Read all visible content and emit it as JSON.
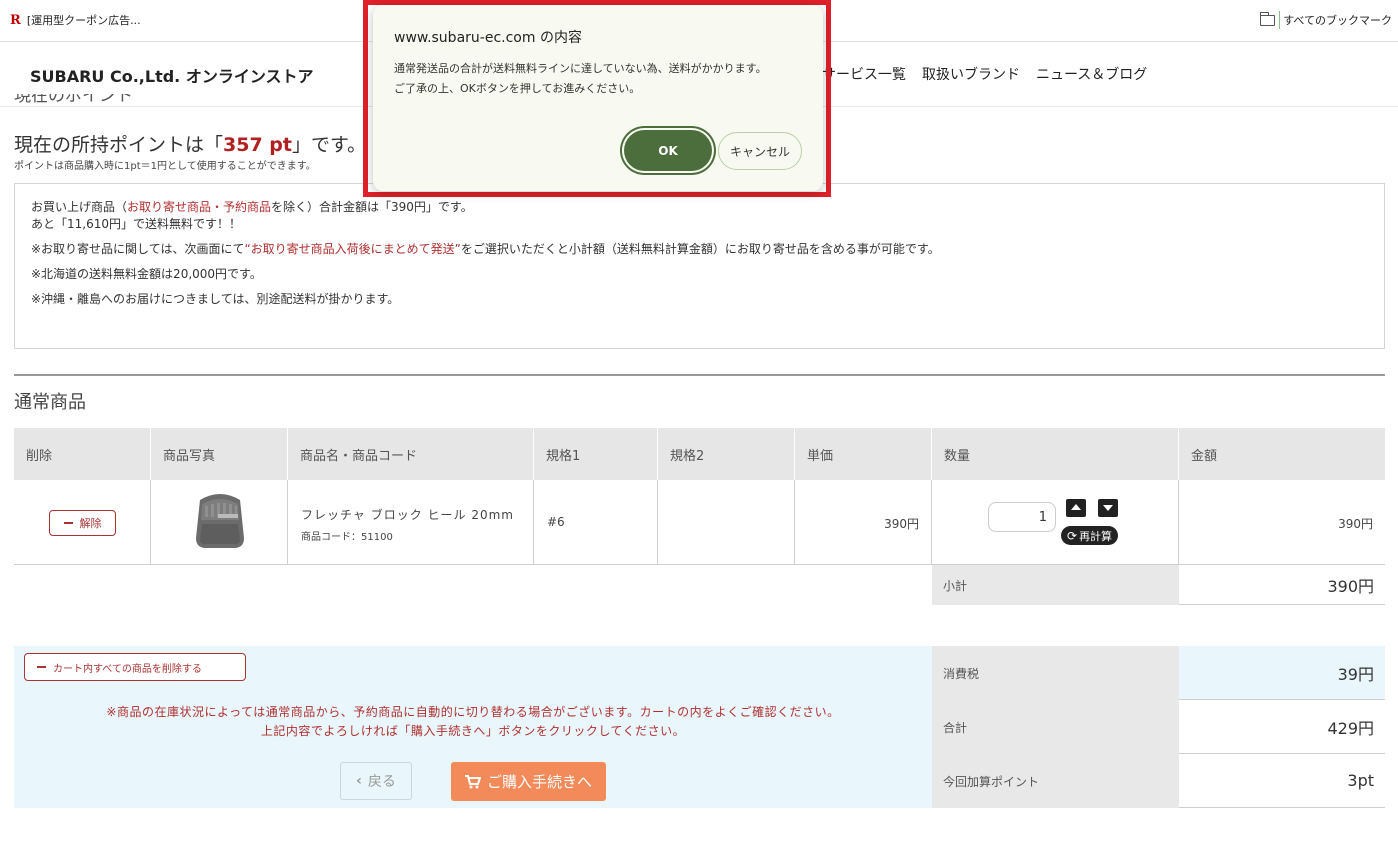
{
  "bookmarks": {
    "left_label": "[運用型クーポン広告...",
    "right_label": "すべてのブックマーク"
  },
  "header": {
    "site_title": "SUBARU Co.,Ltd. オンラインストア",
    "nav": [
      "サービス一覧",
      "取扱いブランド",
      "ニュース＆ブログ"
    ]
  },
  "points": {
    "cut_heading": "現在のポイント",
    "prefix": "現在の所持ポイントは「",
    "value": "357 pt",
    "suffix": "」です。",
    "note": "ポイントは商品購入時に1pt＝1円として使用することができます。"
  },
  "info": {
    "line1_a": "お買い上げ商品（",
    "line1_red": "お取り寄せ商品・予約商品",
    "line1_b": "を除く）合計金額は「390円」です。",
    "line2": "あと「11,610円」で送料無料です！！",
    "line3_a": "※お取り寄せ品に関しては、次画面にて",
    "line3_red": "“お取り寄せ商品入荷後にまとめて発送”",
    "line3_b": "をご選択いただくと小計額（送料無料計算金額）にお取り寄せ品を含める事が可能です。",
    "line4": "※北海道の送料無料金額は20,000円です。",
    "line5": "※沖縄・離島へのお届けにつきましては、別途配送料が掛かります。"
  },
  "section_title": "通常商品",
  "table": {
    "headers": [
      "削除",
      "商品写真",
      "商品名・商品コード",
      "規格1",
      "規格2",
      "単価",
      "数量",
      "金額"
    ],
    "row": {
      "remove_label": "解除",
      "name": "フレッチャ ブロック ヒール 20mm",
      "code": "商品コード：51100",
      "spec1": "#6",
      "spec2": "",
      "unit_price": "390円",
      "quantity": "1",
      "recalc_label": "再計算",
      "amount": "390円"
    }
  },
  "summary": {
    "subtotal_label": "小計",
    "subtotal_value": "390円",
    "tax_label": "消費税",
    "tax_value": "39円",
    "total_label": "合計",
    "total_value": "429円",
    "points_label": "今回加算ポイント",
    "points_value": "3pt"
  },
  "bottom": {
    "clear_cart_label": "カート内すべての商品を削除する",
    "notice1": "※商品の在庫状況によっては通常商品から、予約商品に自動的に切り替わる場合がございます。カートの内をよくご確認ください。",
    "notice2": "上記内容でよろしければ「購入手続きへ」ボタンをクリックしてください。",
    "back_label": "戻る",
    "checkout_label": "ご購入手続きへ"
  },
  "dialog": {
    "title": "www.subaru-ec.com の内容",
    "message1": "通常発送品の合計が送料無料ラインに達していない為、送料がかかります。",
    "message2": "ご了承の上、OKボタンを押してお進みください。",
    "ok_label": "OK",
    "cancel_label": "キャンセル"
  },
  "colors": {
    "accent_red": "#b03030",
    "checkout_orange": "#f28a5a",
    "ok_green": "#4b6e3c",
    "highlight_red": "#e0202a"
  }
}
